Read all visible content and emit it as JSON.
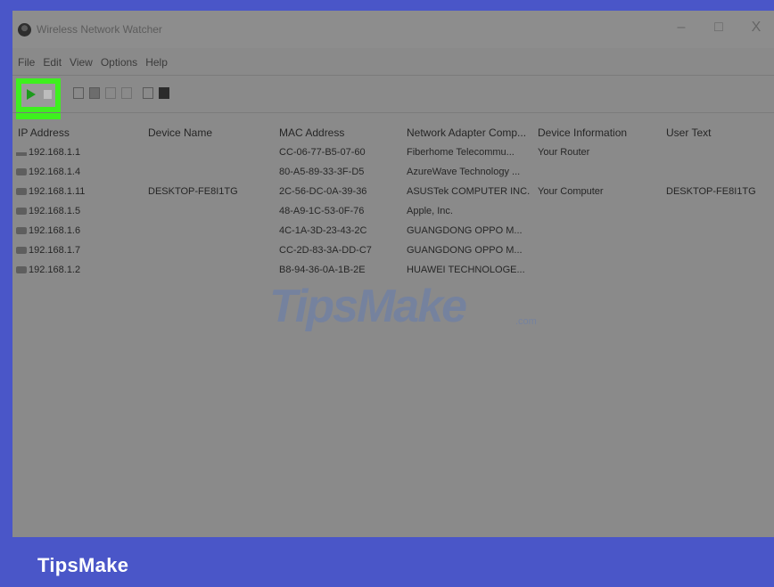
{
  "window": {
    "title": "Wireless Network Watcher",
    "controls": {
      "minimize": "–",
      "maximize": "□",
      "close": "X"
    }
  },
  "menu": {
    "items": [
      {
        "label": "File"
      },
      {
        "label": "Edit"
      },
      {
        "label": "View"
      },
      {
        "label": "Options"
      },
      {
        "label": "Help"
      }
    ]
  },
  "table": {
    "columns": [
      {
        "label": "IP Address"
      },
      {
        "label": "Device Name"
      },
      {
        "label": "MAC Address"
      },
      {
        "label": "Network Adapter Comp..."
      },
      {
        "label": "Device Information"
      },
      {
        "label": "User Text"
      }
    ],
    "rows": [
      {
        "ip": "192.168.1.1",
        "device": "",
        "mac": "CC-06-77-B5-07-60",
        "adapter": "Fiberhome Telecommu...",
        "info": "Your Router",
        "user": ""
      },
      {
        "ip": "192.168.1.4",
        "device": "",
        "mac": "80-A5-89-33-3F-D5",
        "adapter": "AzureWave Technology ...",
        "info": "",
        "user": ""
      },
      {
        "ip": "192.168.1.11",
        "device": "DESKTOP-FE8I1TG",
        "mac": "2C-56-DC-0A-39-36",
        "adapter": "ASUSTek COMPUTER INC.",
        "info": "Your Computer",
        "user": "DESKTOP-FE8I1TG"
      },
      {
        "ip": "192.168.1.5",
        "device": "",
        "mac": "48-A9-1C-53-0F-76",
        "adapter": "Apple, Inc.",
        "info": "",
        "user": ""
      },
      {
        "ip": "192.168.1.6",
        "device": "",
        "mac": "4C-1A-3D-23-43-2C",
        "adapter": "GUANGDONG OPPO M...",
        "info": "",
        "user": ""
      },
      {
        "ip": "192.168.1.7",
        "device": "",
        "mac": "CC-2D-83-3A-DD-C7",
        "adapter": "GUANGDONG OPPO M...",
        "info": "",
        "user": ""
      },
      {
        "ip": "192.168.1.2",
        "device": "",
        "mac": "B8-94-36-0A-1B-2E",
        "adapter": "HUAWEI TECHNOLOGE...",
        "info": "",
        "user": ""
      }
    ]
  },
  "watermark": {
    "main": "TipsMake",
    "suffix": ".com"
  },
  "brand": {
    "label": "TipsMake"
  },
  "colors": {
    "background": "#4a56c8",
    "window": "#8a8a8a",
    "highlight": "#3ef01e",
    "play": "#1c9b1c"
  }
}
